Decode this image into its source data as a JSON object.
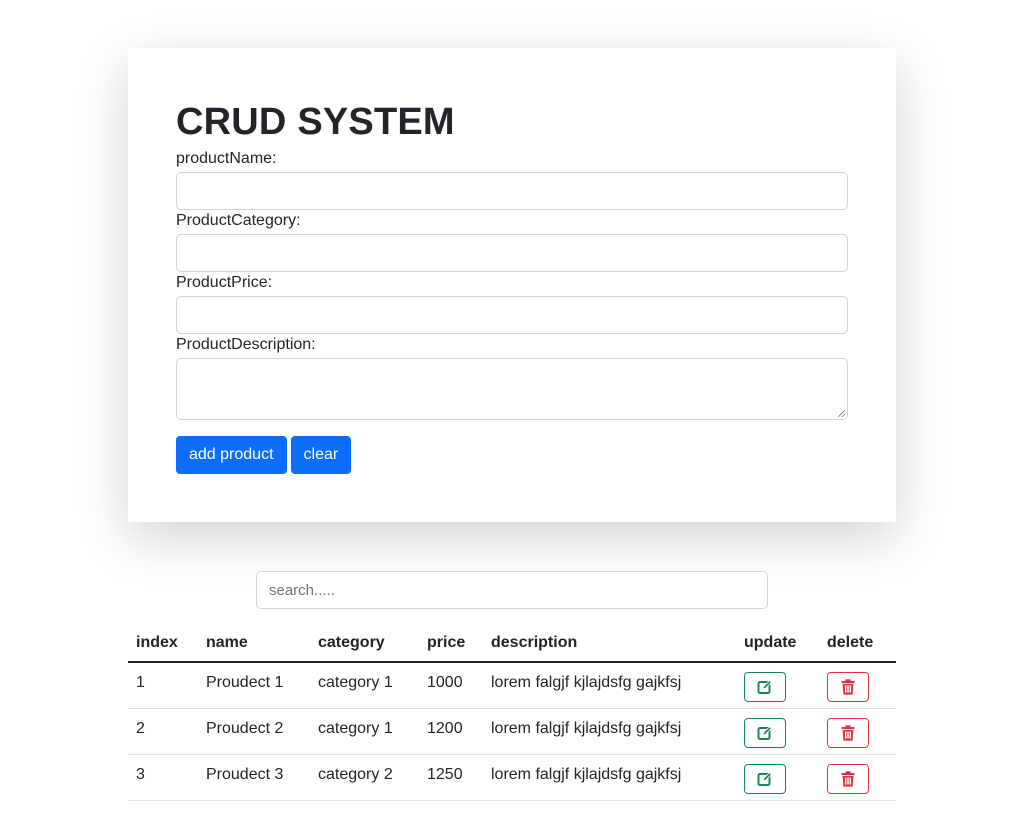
{
  "form": {
    "title": "CRUD SYSTEM",
    "name_label": "productName:",
    "category_label": "ProductCategory:",
    "price_label": "ProductPrice:",
    "description_label": "ProductDescription:",
    "name_value": "",
    "category_value": "",
    "price_value": "",
    "description_value": "",
    "add_button": "add product",
    "clear_button": "clear"
  },
  "search": {
    "placeholder": "search.....",
    "value": ""
  },
  "table": {
    "headers": {
      "index": "index",
      "name": "name",
      "category": "category",
      "price": "price",
      "description": "description",
      "update": "update",
      "delete": "delete"
    },
    "rows": [
      {
        "index": "1",
        "name": "Proudect 1",
        "category": "category 1",
        "price": "1000",
        "description": "lorem falgjf kjlajdsfg gajkfsj"
      },
      {
        "index": "2",
        "name": "Proudect 2",
        "category": "category 1",
        "price": "1200",
        "description": "lorem falgjf kjlajdsfg gajkfsj"
      },
      {
        "index": "3",
        "name": "Proudect 3",
        "category": "category 2",
        "price": "1250",
        "description": "lorem falgjf kjlajdsfg gajkfsj"
      }
    ],
    "update_icon": "edit-icon",
    "delete_icon": "trash-icon"
  },
  "colors": {
    "primary": "#0d6efd",
    "success": "#198754",
    "danger": "#dc3545"
  }
}
